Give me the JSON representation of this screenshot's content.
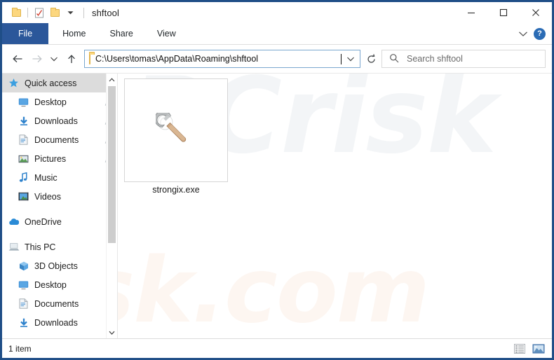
{
  "window": {
    "title": "shftool",
    "quick_access_toolbar": [
      {
        "name": "folder-icon",
        "label": "Folder"
      },
      {
        "name": "properties-icon",
        "label": "Properties"
      },
      {
        "name": "new-folder-icon",
        "label": "New folder"
      },
      {
        "name": "customize-dropdown-icon",
        "label": "Customize Quick Access Toolbar"
      }
    ],
    "controls": {
      "minimize": "—",
      "maximize": "☐",
      "close": "✕"
    }
  },
  "ribbon": {
    "tabs": [
      {
        "label": "File",
        "active": true
      },
      {
        "label": "Home",
        "active": false
      },
      {
        "label": "Share",
        "active": false
      },
      {
        "label": "View",
        "active": false
      }
    ],
    "expand_label": "⌄",
    "help_label": "?"
  },
  "navbar": {
    "back_label": "←",
    "forward_label": "→",
    "recent_label": "⌄",
    "up_label": "↑",
    "address": {
      "value": "C:\\Users\\tomas\\AppData\\Roaming\\shftool",
      "dropdown_label": "⌄"
    },
    "refresh_label": "↻",
    "search": {
      "placeholder": "Search shftool",
      "value": ""
    }
  },
  "sidebar": {
    "items": [
      {
        "label": "Quick access",
        "icon": "star-icon",
        "selected": true,
        "pinned": false,
        "indent": 0
      },
      {
        "label": "Desktop",
        "icon": "desktop-icon",
        "selected": false,
        "pinned": true,
        "indent": 1
      },
      {
        "label": "Downloads",
        "icon": "downloads-icon",
        "selected": false,
        "pinned": true,
        "indent": 1
      },
      {
        "label": "Documents",
        "icon": "documents-icon",
        "selected": false,
        "pinned": true,
        "indent": 1
      },
      {
        "label": "Pictures",
        "icon": "pictures-icon",
        "selected": false,
        "pinned": true,
        "indent": 1
      },
      {
        "label": "Music",
        "icon": "music-icon",
        "selected": false,
        "pinned": false,
        "indent": 1
      },
      {
        "label": "Videos",
        "icon": "videos-icon",
        "selected": false,
        "pinned": false,
        "indent": 1
      },
      {
        "label": "OneDrive",
        "icon": "onedrive-icon",
        "selected": false,
        "pinned": false,
        "indent": 0
      },
      {
        "label": "This PC",
        "icon": "thispc-icon",
        "selected": false,
        "pinned": false,
        "indent": 0
      },
      {
        "label": "3D Objects",
        "icon": "3dobjects-icon",
        "selected": false,
        "pinned": false,
        "indent": 1
      },
      {
        "label": "Desktop",
        "icon": "desktop-icon",
        "selected": false,
        "pinned": false,
        "indent": 1
      },
      {
        "label": "Documents",
        "icon": "documents-icon",
        "selected": false,
        "pinned": false,
        "indent": 1
      },
      {
        "label": "Downloads",
        "icon": "downloads-icon",
        "selected": false,
        "pinned": false,
        "indent": 1
      }
    ],
    "scroll_up_label": "⌃",
    "scroll_down_label": "⌄"
  },
  "files": {
    "items": [
      {
        "name": "strongix.exe",
        "icon": "wrench-icon"
      }
    ]
  },
  "watermark": {
    "line1": "PCrisk",
    "line2": "sk.com"
  },
  "statusbar": {
    "count_label": "1 item",
    "views": [
      {
        "name": "details-view-button",
        "active": false
      },
      {
        "name": "large-icons-view-button",
        "active": true
      }
    ]
  },
  "colors": {
    "accent": "#2b579a",
    "window_border": "#1f4e87",
    "address_border": "#7ba7cf",
    "selection": "#dcdcdc",
    "help_blue": "#2b6cb5"
  }
}
